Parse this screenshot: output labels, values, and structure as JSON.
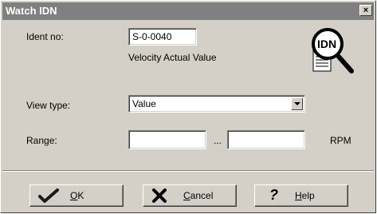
{
  "window": {
    "title": "Watch IDN",
    "close_glyph": "×"
  },
  "form": {
    "ident_label": "Ident no:",
    "ident_value": "S-0-0040",
    "ident_description": "Velocity Actual Value",
    "view_type_label": "View type:",
    "view_type_value": "Value",
    "range_label": "Range:",
    "range_min": "",
    "range_max": "",
    "range_separator": "...",
    "range_unit": "RPM"
  },
  "badge": {
    "text": "IDN",
    "icon": "magnifier-document-icon"
  },
  "buttons": {
    "ok_label": "OK",
    "cancel_label": "Cancel",
    "help_label": "Help"
  },
  "colors": {
    "titlebar": "#808080",
    "dialog_bg": "#d4d0c8",
    "ok_check": "#1a1a1a"
  }
}
